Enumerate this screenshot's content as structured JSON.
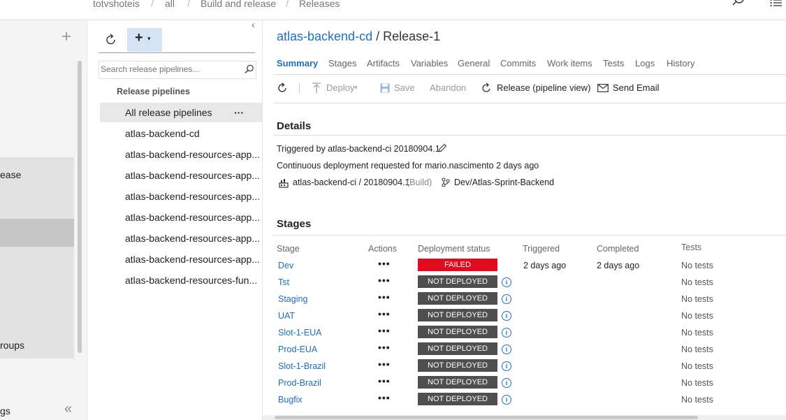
{
  "breadcrumb": [
    "totvshoteis",
    "all",
    "Build and release",
    "Releases"
  ],
  "leftnav": {
    "items": [
      "ease",
      "roups",
      "gs"
    ],
    "collapse_glyph": "«"
  },
  "pipelines": {
    "search_placeholder": "Search release pipelines...",
    "section_title": "Release pipelines",
    "items": [
      "All release pipelines",
      "atlas-backend-cd",
      "atlas-backend-resources-app...",
      "atlas-backend-resources-app...",
      "atlas-backend-resources-app...",
      "atlas-backend-resources-app...",
      "atlas-backend-resources-app...",
      "atlas-backend-resources-app...",
      "atlas-backend-resources-fun..."
    ],
    "more_glyph": "···"
  },
  "release": {
    "pipeline": "atlas-backend-cd",
    "separator": "/",
    "name": "Release-1"
  },
  "tabs": [
    "Summary",
    "Stages",
    "Artifacts",
    "Variables",
    "General",
    "Commits",
    "Work items",
    "Tests",
    "Logs",
    "History"
  ],
  "toolbar": {
    "deploy": "Deploy",
    "save": "Save",
    "abandon": "Abandon",
    "release_view": "Release (pipeline view)",
    "send_email": "Send Email"
  },
  "details": {
    "title": "Details",
    "triggered": "Triggered by atlas-backend-ci 20180904.1.",
    "cd_line": "Continuous deployment requested for mario.nascimento 2 days ago",
    "artifact_name": "atlas-backend-ci / 20180904.1",
    "artifact_type": "(Build)",
    "branch": "Dev/Atlas-Sprint-Backend"
  },
  "stages": {
    "title": "Stages",
    "headers": {
      "stage": "Stage",
      "actions": "Actions",
      "status": "Deployment status",
      "triggered": "Triggered",
      "completed": "Completed",
      "tests": "Tests"
    },
    "rows": [
      {
        "name": "Dev",
        "status": "FAILED",
        "triggered": "2 days ago",
        "completed": "2 days ago",
        "tests": "No tests"
      },
      {
        "name": "Tst",
        "status": "NOT DEPLOYED",
        "triggered": "",
        "completed": "",
        "tests": "No tests"
      },
      {
        "name": "Staging",
        "status": "NOT DEPLOYED",
        "triggered": "",
        "completed": "",
        "tests": "No tests"
      },
      {
        "name": "UAT",
        "status": "NOT DEPLOYED",
        "triggered": "",
        "completed": "",
        "tests": "No tests"
      },
      {
        "name": "Slot-1-EUA",
        "status": "NOT DEPLOYED",
        "triggered": "",
        "completed": "",
        "tests": "No tests"
      },
      {
        "name": "Prod-EUA",
        "status": "NOT DEPLOYED",
        "triggered": "",
        "completed": "",
        "tests": "No tests"
      },
      {
        "name": "Slot-1-Brazil",
        "status": "NOT DEPLOYED",
        "triggered": "",
        "completed": "",
        "tests": "No tests"
      },
      {
        "name": "Prod-Brazil",
        "status": "NOT DEPLOYED",
        "triggered": "",
        "completed": "",
        "tests": "No tests"
      },
      {
        "name": "Bugfix",
        "status": "NOT DEPLOYED",
        "triggered": "",
        "completed": "",
        "tests": "No tests"
      }
    ],
    "actions_glyph": "•••",
    "info_glyph": "i"
  },
  "colors": {
    "link_blue": "#1e6fbf",
    "failed_red": "#e00b1c",
    "not_deployed_gray": "#4f4f4f"
  }
}
